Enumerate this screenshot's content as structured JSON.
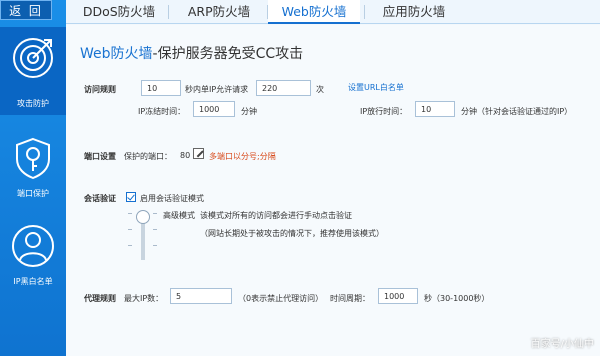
{
  "sidebar": {
    "back_label": "返 回",
    "items": [
      {
        "label": "攻击防护",
        "icon": "target-icon",
        "active": true
      },
      {
        "label": "端口保护",
        "icon": "key-lock-icon",
        "active": false
      },
      {
        "label": "IP黑白名单",
        "icon": "user-icon",
        "active": false
      }
    ]
  },
  "tabs": [
    {
      "label": "DDoS防火墙",
      "active": false
    },
    {
      "label": "ARP防火墙",
      "active": false
    },
    {
      "label": "Web防火墙",
      "active": true
    },
    {
      "label": "应用防火墙",
      "active": false
    }
  ],
  "page": {
    "title_prefix": "Web防火墙",
    "title_suffix": "-保护服务器免受CC攻击"
  },
  "access_rule": {
    "label": "访问规则",
    "seconds_value": "10",
    "seconds_text": "秒内单IP允许请求",
    "requests_value": "220",
    "times_text": "次",
    "whitelist_link": "设置URL白名单",
    "freeze_label": "IP冻结时间：",
    "freeze_value": "1000",
    "freeze_unit": "分钟",
    "release_label": "IP放行时间：",
    "release_value": "10",
    "release_unit": "分钟（针对会话验证通过的IP）"
  },
  "port_settings": {
    "label": "端口设置",
    "protected_label": "保护的端口：",
    "port_value": "80",
    "multi_port_hint": "多端口以分号;分隔"
  },
  "session_verify": {
    "label": "会话验证",
    "enable_label": "启用会话验证模式",
    "mode_name": "高级模式",
    "mode_desc": "该模式对所有的访问都会进行手动点击验证",
    "mode_note": "（网站长期处于被攻击的情况下，推荐使用该模式）",
    "checked": true,
    "slider_level": 1.0
  },
  "proxy_rule": {
    "label": "代理规则",
    "max_ip_label": "最大IP数：",
    "max_ip_value": "5",
    "max_ip_hint": "（0表示禁止代理访问）",
    "period_label": "时间周期：",
    "period_value": "1000",
    "period_unit": "秒（30-1000秒）"
  },
  "watermark": "百家号/小仙中"
}
